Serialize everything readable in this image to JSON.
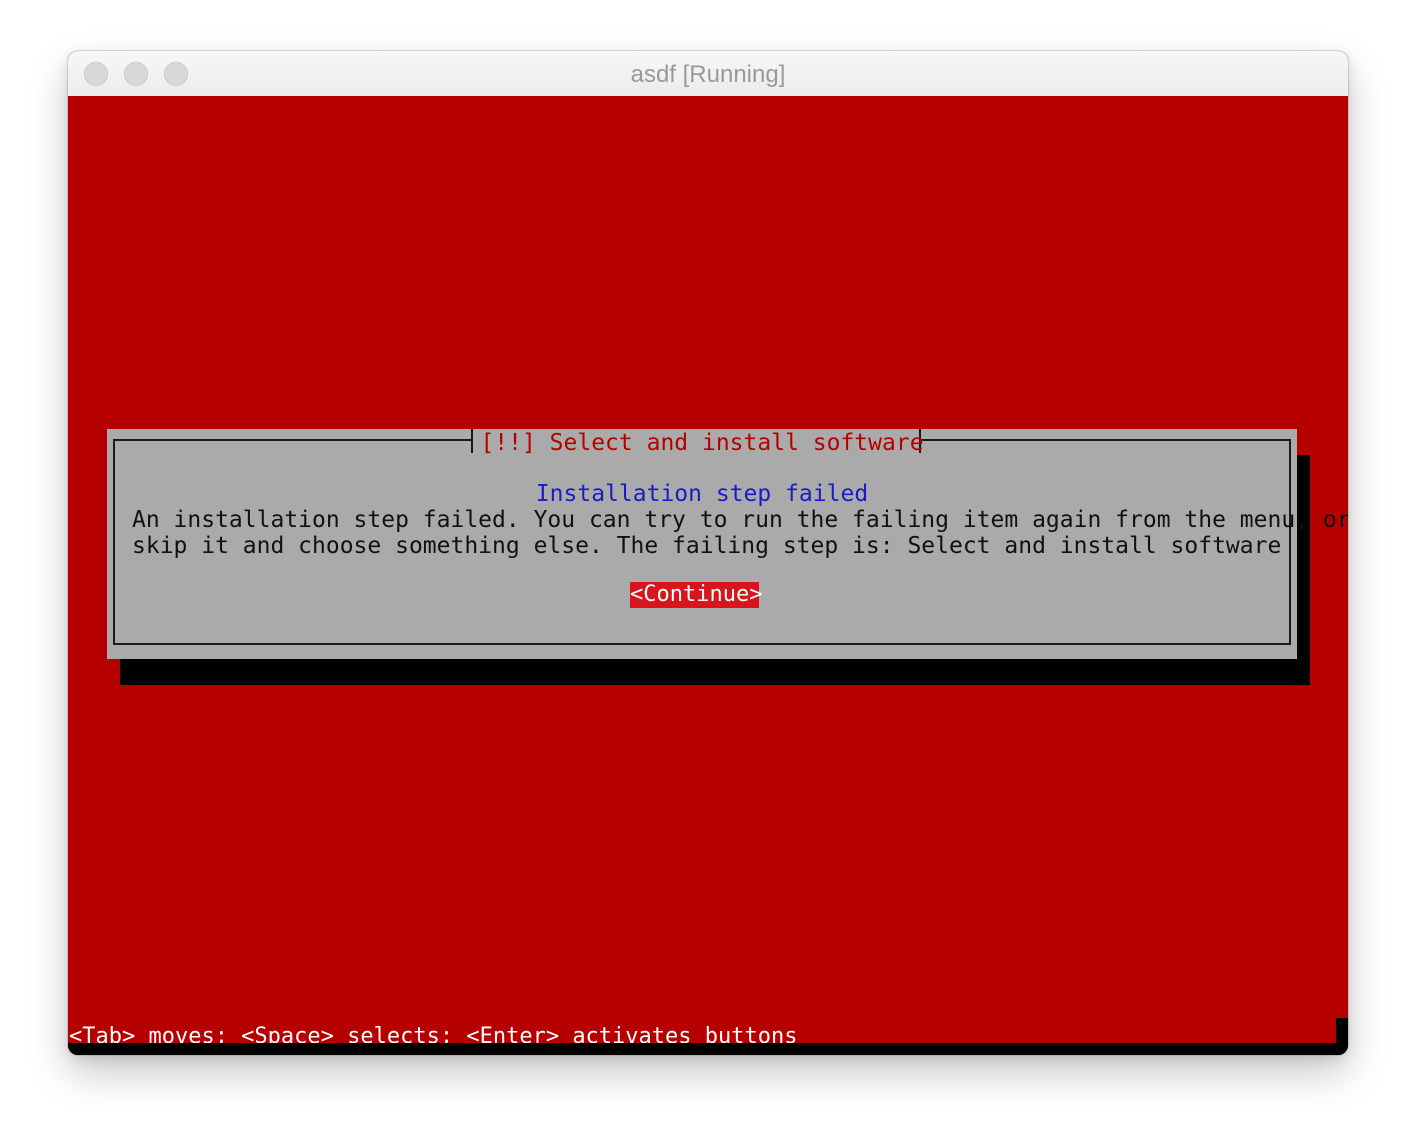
{
  "window": {
    "title": "asdf [Running]"
  },
  "dialog": {
    "title": "[!!] Select and install software",
    "subtitle": "Installation step failed",
    "body_lines": [
      "An installation step failed. You can try to run the failing item again from the menu, or",
      "skip it and choose something else. The failing step is: Select and install software"
    ],
    "continue_label": "<Continue>"
  },
  "footer": {
    "help_text": "<Tab> moves; <Space> selects; <Enter> activates buttons"
  },
  "colors": {
    "background": "#b60000",
    "dialog": "#aaaaaa",
    "subtitle": "#1a1acc",
    "button_focus": "#d8141c"
  }
}
